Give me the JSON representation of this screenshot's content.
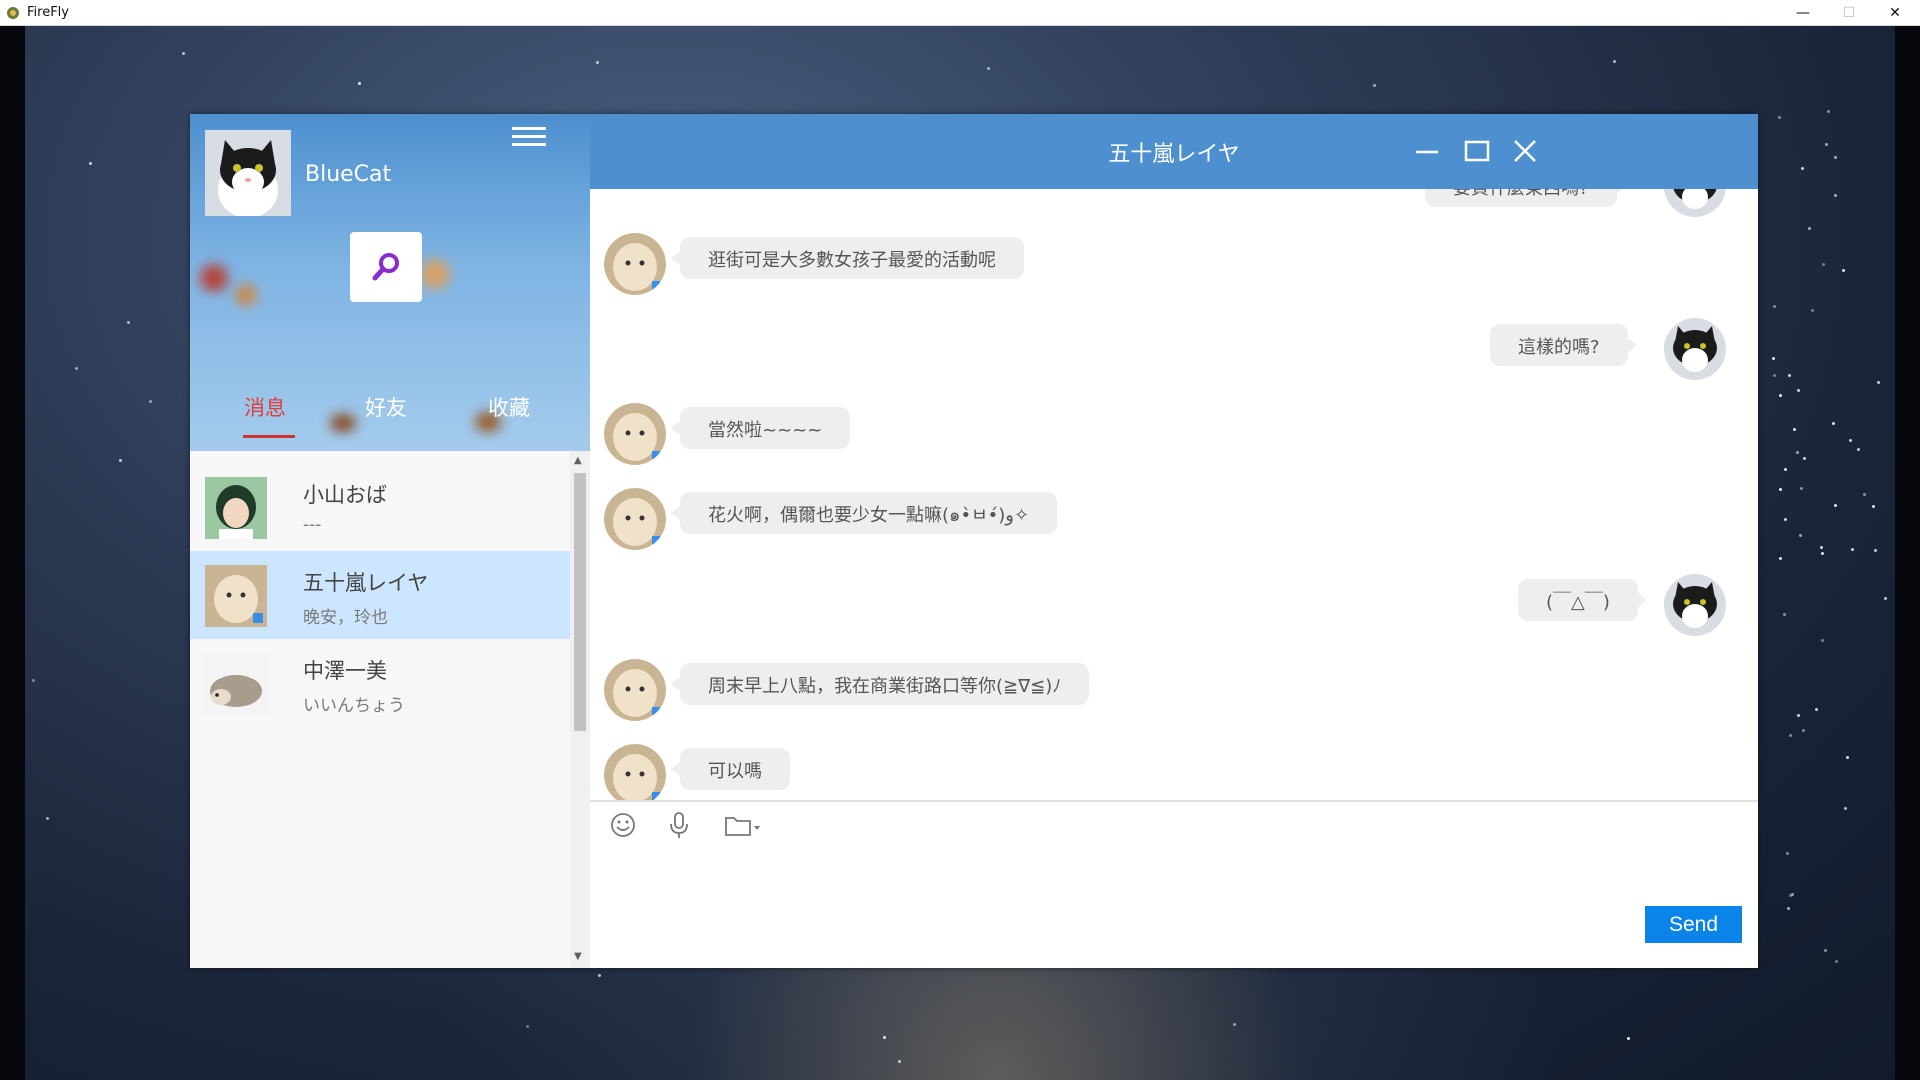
{
  "os_window": {
    "title": "FireFly"
  },
  "profile": {
    "username": "BlueCat"
  },
  "tabs": [
    {
      "label": "消息",
      "active": true
    },
    {
      "label": "好友",
      "active": false
    },
    {
      "label": "收藏",
      "active": false
    }
  ],
  "contacts": [
    {
      "name": "小山おば",
      "preview": "---",
      "selected": false,
      "avatar": "girl-avatar"
    },
    {
      "name": "五十嵐レイヤ",
      "preview": "晚安，玲也",
      "selected": true,
      "avatar": "alpaca-avatar"
    },
    {
      "name": "中澤一美",
      "preview": "いいんちょう",
      "selected": false,
      "avatar": "hedgehog-avatar"
    }
  ],
  "chat": {
    "title": "五十嵐レイヤ",
    "messages": [
      {
        "from": "me",
        "text": "要買什麼東西嗎?"
      },
      {
        "from": "them",
        "text": "逛街可是大多數女孩子最愛的活動呢"
      },
      {
        "from": "me",
        "text": "這樣的嗎?"
      },
      {
        "from": "them",
        "text": "當然啦~~~~"
      },
      {
        "from": "them",
        "text": "花火啊，偶爾也要少女一點嘛(๑•̀ㅂ•́)و✧"
      },
      {
        "from": "me",
        "text": "(￣△￣)"
      },
      {
        "from": "them",
        "text": "周末早上八點，我在商業街路口等你(≧∇≦)ﾉ"
      },
      {
        "from": "them",
        "text": "可以嗎"
      }
    ]
  },
  "composer": {
    "send_label": "Send"
  },
  "colors": {
    "header_blue": "#4d8fcf",
    "send_blue": "#0a84e8",
    "active_tab_red": "#d0342e",
    "selected_row": "#cde6ff"
  }
}
